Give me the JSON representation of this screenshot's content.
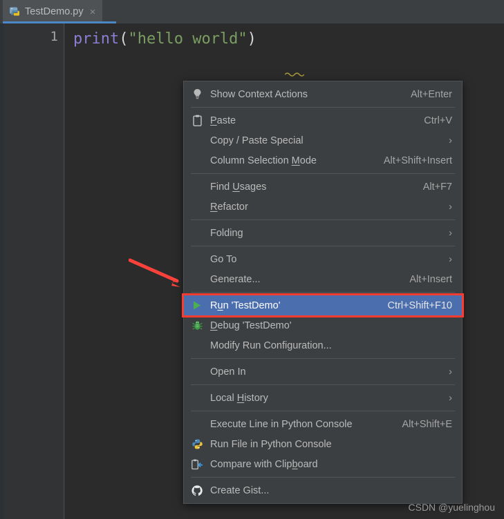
{
  "window": {
    "background": "#2b2b2b",
    "panel_background": "#3c3f41",
    "accent_selection": "#4b6eaf",
    "annotation_color": "#ff3b30"
  },
  "tab": {
    "icon": "python-file-icon",
    "label": "TestDemo.py",
    "close_glyph": "×"
  },
  "editor": {
    "line_number": "1",
    "code": {
      "keyword": "print",
      "open_paren": "(",
      "string": "\"hello world\"",
      "close_paren": ")"
    }
  },
  "context_menu": {
    "groups": [
      {
        "items": [
          {
            "icon": "lightbulb-icon",
            "label_pre": "Show Context Actions",
            "mnemonic": "",
            "label_post": "",
            "accel": "Alt+Enter",
            "submenu": false,
            "selected": false
          }
        ]
      },
      {
        "items": [
          {
            "icon": "clipboard-icon",
            "label_pre": "",
            "mnemonic": "P",
            "label_post": "aste",
            "accel": "Ctrl+V",
            "submenu": false,
            "selected": false
          },
          {
            "icon": "",
            "label_pre": "Copy / Paste Special",
            "mnemonic": "",
            "label_post": "",
            "accel": "",
            "submenu": true,
            "selected": false
          },
          {
            "icon": "",
            "label_pre": "Column Selection ",
            "mnemonic": "M",
            "label_post": "ode",
            "accel": "Alt+Shift+Insert",
            "submenu": false,
            "selected": false
          }
        ]
      },
      {
        "items": [
          {
            "icon": "",
            "label_pre": "Find ",
            "mnemonic": "U",
            "label_post": "sages",
            "accel": "Alt+F7",
            "submenu": false,
            "selected": false
          },
          {
            "icon": "",
            "label_pre": "",
            "mnemonic": "R",
            "label_post": "efactor",
            "accel": "",
            "submenu": true,
            "selected": false
          }
        ]
      },
      {
        "items": [
          {
            "icon": "",
            "label_pre": "Folding",
            "mnemonic": "",
            "label_post": "",
            "accel": "",
            "submenu": true,
            "selected": false
          }
        ]
      },
      {
        "items": [
          {
            "icon": "",
            "label_pre": "Go To",
            "mnemonic": "",
            "label_post": "",
            "accel": "",
            "submenu": true,
            "selected": false
          },
          {
            "icon": "",
            "label_pre": "Generate...",
            "mnemonic": "",
            "label_post": "",
            "accel": "Alt+Insert",
            "submenu": false,
            "selected": false
          }
        ]
      },
      {
        "items": [
          {
            "icon": "run-play-icon",
            "label_pre": "R",
            "mnemonic": "u",
            "label_post": "n 'TestDemo'",
            "accel": "Ctrl+Shift+F10",
            "submenu": false,
            "selected": true
          },
          {
            "icon": "debug-bug-icon",
            "label_pre": "",
            "mnemonic": "D",
            "label_post": "ebug 'TestDemo'",
            "accel": "",
            "submenu": false,
            "selected": false
          },
          {
            "icon": "",
            "label_pre": "Modify Run Configuration...",
            "mnemonic": "",
            "label_post": "",
            "accel": "",
            "submenu": false,
            "selected": false
          }
        ]
      },
      {
        "items": [
          {
            "icon": "",
            "label_pre": "Open In",
            "mnemonic": "",
            "label_post": "",
            "accel": "",
            "submenu": true,
            "selected": false
          }
        ]
      },
      {
        "items": [
          {
            "icon": "",
            "label_pre": "Local ",
            "mnemonic": "H",
            "label_post": "istory",
            "accel": "",
            "submenu": true,
            "selected": false
          }
        ]
      },
      {
        "items": [
          {
            "icon": "",
            "label_pre": "Execute Line in Python Console",
            "mnemonic": "",
            "label_post": "",
            "accel": "Alt+Shift+E",
            "submenu": false,
            "selected": false
          },
          {
            "icon": "python-logo-icon",
            "label_pre": "Run File in Python Console",
            "mnemonic": "",
            "label_post": "",
            "accel": "",
            "submenu": false,
            "selected": false
          },
          {
            "icon": "compare-clipboard-icon",
            "label_pre": "Compare with Clip",
            "mnemonic": "b",
            "label_post": "oard",
            "accel": "",
            "submenu": false,
            "selected": false
          }
        ]
      },
      {
        "items": [
          {
            "icon": "github-icon",
            "label_pre": "Create Gist...",
            "mnemonic": "",
            "label_post": "",
            "accel": "",
            "submenu": false,
            "selected": false
          }
        ]
      }
    ]
  },
  "annotations": {
    "arrow": "red-arrow-annotation",
    "highlight_box": "red-highlight-box-annotation"
  },
  "watermark": "CSDN @yuelinghou"
}
